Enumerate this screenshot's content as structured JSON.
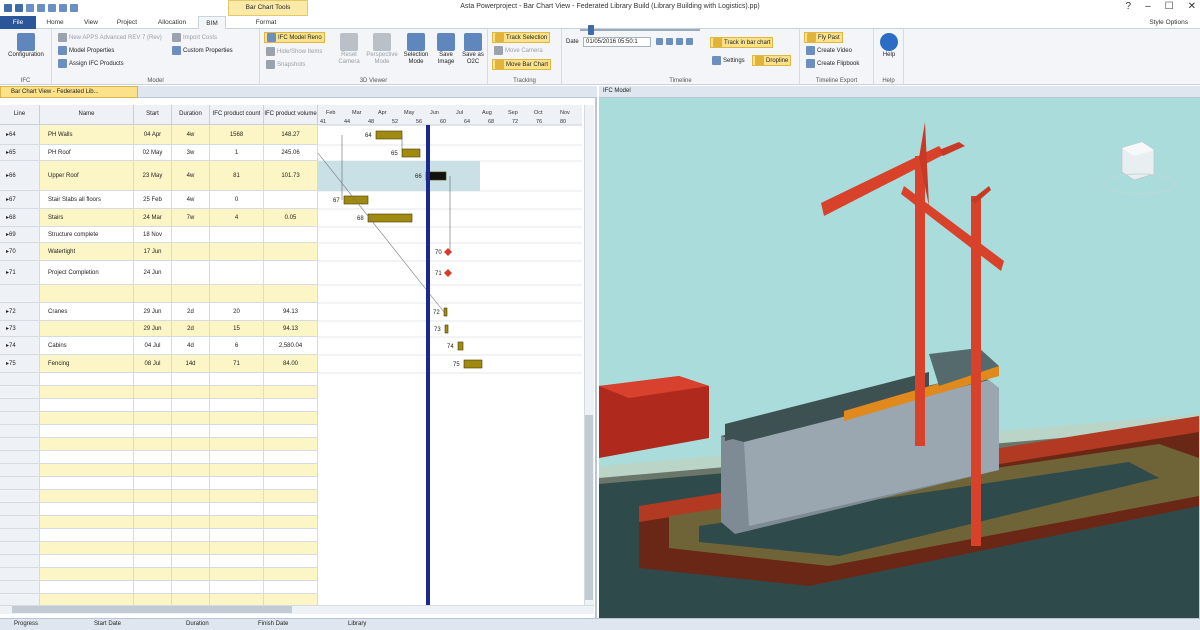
{
  "titlebar": {
    "contextual_tab": "Bar Chart Tools",
    "window_title": "Asta Powerproject - Bar Chart View - Federated Library Build (Library Building with Logistics).pp)"
  },
  "tabs": [
    "File",
    "Home",
    "View",
    "Project",
    "Allocation",
    "BIM",
    "Format"
  ],
  "style_options": "Style Options",
  "ribbon": {
    "ifc": {
      "configuration": "Configuration",
      "label": "IFC"
    },
    "model": {
      "new_model": "New APPS Advanced REV 7 (Rev)",
      "model_properties": "Model Properties",
      "assign_ifc": "Assign IFC Products",
      "import_costs": "Import Costs",
      "custom_properties": "Custom Properties",
      "label": "Model"
    },
    "viewer": {
      "ifc_model_reno": "IFC Model Reno",
      "hide_show_items": "Hide/Show Items",
      "snapshots": "Snapshots",
      "reset_camera": "Reset Camera",
      "perspective_mode": "Perspective Mode",
      "selection_mode": "Selection Mode",
      "save_image": "Save Image",
      "save_o2c": "Save as O2C",
      "label": "3D Viewer"
    },
    "tracking": {
      "track_selection": "Track Selection",
      "move_camera": "Move Camera",
      "move_bar_chart": "Move Bar Chart",
      "label": "Tracking"
    },
    "timeline": {
      "date_label": "Date",
      "date_value": "01/05/2016 05:50:1",
      "track_in_bar_chart": "Track in bar chart",
      "settings": "Settings",
      "dropline": "Dropline",
      "label": "Timeline"
    },
    "export": {
      "fly_past": "Fly Past",
      "create_video": "Create Video",
      "create_flipbook": "Create Flipbook",
      "label": "Timeline Export"
    },
    "help": {
      "help": "Help",
      "label": "Help"
    }
  },
  "left_panel": {
    "tab_title": "Bar Chart View - Federated Lib..."
  },
  "right_panel": {
    "title": "IFC Model"
  },
  "grid": {
    "headers": [
      "Line",
      "Name",
      "Start",
      "Duration",
      "IFC product count",
      "IFC product volume"
    ],
    "rows": [
      {
        "line": "64",
        "name": "PH Walls",
        "start": "04 Apr",
        "duration": "4w",
        "count": "1568",
        "volume": "148.27",
        "yellow": true,
        "h": 20
      },
      {
        "line": "65",
        "name": "PH Roof",
        "start": "02 May",
        "duration": "3w",
        "count": "1",
        "volume": "245.06",
        "yellow": false,
        "h": 16
      },
      {
        "line": "66",
        "name": "Upper Roof",
        "start": "23 May",
        "duration": "4w",
        "count": "81",
        "volume": "101.73",
        "yellow": true,
        "h": 30
      },
      {
        "line": "67",
        "name": "Stair Slabs all floors",
        "start": "25 Feb",
        "duration": "4w",
        "count": "0",
        "volume": "",
        "yellow": false,
        "h": 18
      },
      {
        "line": "68",
        "name": "Stairs",
        "start": "24 Mar",
        "duration": "7w",
        "count": "4",
        "volume": "0.05",
        "yellow": true,
        "h": 18
      },
      {
        "line": "69",
        "name": "Structure complete",
        "start": "18 Nov",
        "duration": "",
        "count": "",
        "volume": "",
        "yellow": false,
        "h": 16
      },
      {
        "line": "70",
        "name": "Watertight",
        "start": "17 Jun",
        "duration": "",
        "count": "",
        "volume": "",
        "yellow": true,
        "h": 18
      },
      {
        "line": "71",
        "name": "Project Completion",
        "start": "24 Jun",
        "duration": "",
        "count": "",
        "volume": "",
        "yellow": false,
        "h": 24
      },
      {
        "line": "",
        "name": "",
        "start": "",
        "duration": "",
        "count": "",
        "volume": "",
        "yellow": true,
        "h": 18
      },
      {
        "line": "72",
        "name": "Cranes",
        "start": "29 Jun",
        "duration": "2d",
        "count": "20",
        "volume": "94.13",
        "yellow": false,
        "h": 18
      },
      {
        "line": "73",
        "name": "",
        "start": "29 Jun",
        "duration": "2d",
        "count": "15",
        "volume": "94.13",
        "yellow": true,
        "h": 16
      },
      {
        "line": "74",
        "name": "Cabins",
        "start": "04 Jul",
        "duration": "4d",
        "count": "6",
        "volume": "2,580.04",
        "yellow": false,
        "h": 18
      },
      {
        "line": "75",
        "name": "Fencing",
        "start": "08 Jul",
        "duration": "14d",
        "count": "71",
        "volume": "84.00",
        "yellow": true,
        "h": 18
      }
    ]
  },
  "timescale": {
    "months": [
      "Feb",
      "Mar",
      "Apr",
      "May",
      "Jun",
      "Jul",
      "Aug",
      "Sep",
      "Oct",
      "Nov"
    ],
    "weeks": [
      "41",
      "44",
      "48",
      "52",
      "56",
      "60",
      "64",
      "68",
      "72",
      "76",
      "80"
    ]
  },
  "status_bar": {
    "items": [
      "Progress",
      "Start Date",
      "Duration",
      "Finish Date",
      "Library"
    ]
  }
}
